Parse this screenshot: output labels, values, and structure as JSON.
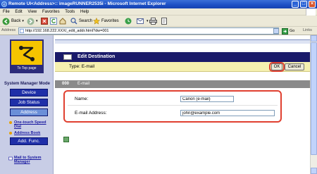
{
  "window": {
    "title": "Remote UI<Address>:: imageRUNNER2535i - Microsoft Internet Explorer",
    "buttons": [
      "_",
      "□",
      "×"
    ]
  },
  "menu": [
    "File",
    "Edit",
    "View",
    "Favorites",
    "Tools",
    "Help"
  ],
  "toolbar": {
    "back": "Back",
    "search": "Search",
    "favorites": "Favorites"
  },
  "address": {
    "label": "Address",
    "url": "http://192.168.222.XXX/_edit_addr.html?dw=001",
    "go": "Go",
    "links": "Links"
  },
  "sidebar": {
    "logo_label": "To Top page",
    "mode_title": "System Manager Mode",
    "buttons": [
      "Device",
      "Job Status",
      "Address"
    ],
    "links": [
      "One-touch Speed Dial",
      "Address Book"
    ],
    "add_func": "Add. Func.",
    "mail_link": "Mail to System Manager"
  },
  "main": {
    "header_title": "Edit Destination",
    "type_label": "Type: E-mail",
    "ok_label": "OK",
    "cancel_label": "Cancel",
    "entry_number": "000",
    "entry_type": "E-mail",
    "form": {
      "name_label": "Name:",
      "name_value": "Canon (e-mail)",
      "email_label": "E-mail Address:",
      "email_value": "john@example.com"
    }
  },
  "colors": {
    "accent_ring": "#e04030",
    "header_bg": "#1a1a6a",
    "sidebar_button": "#1f2fa8"
  }
}
